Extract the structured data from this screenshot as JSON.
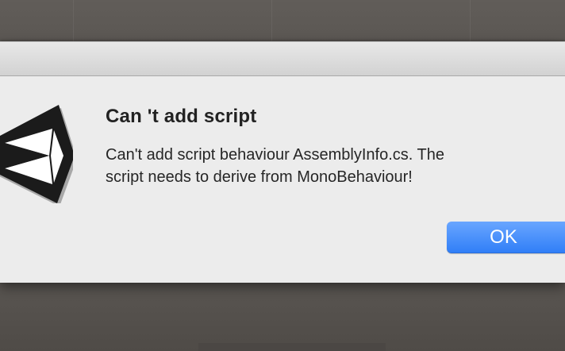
{
  "dialog": {
    "title": "Can 't add script",
    "message_line1": "Can't add script behaviour AssemblyInfo.cs. The",
    "message_line2": "script needs to derive from MonoBehaviour!",
    "ok_label": "OK",
    "icon": "unity-logo-icon"
  },
  "colors": {
    "background": "#5d5955",
    "dialog_background": "#ececec",
    "button_accent": "#2f7ef7",
    "title_text": "#222222"
  }
}
